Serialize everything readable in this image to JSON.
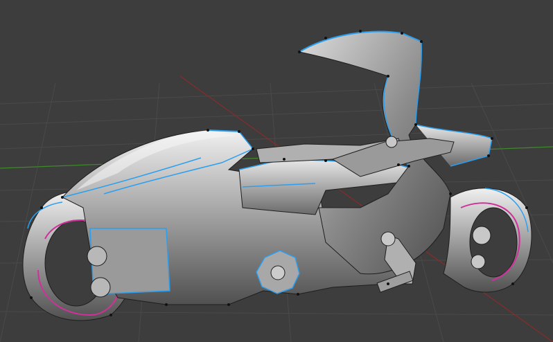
{
  "viewport": {
    "background": "#3d3d3d",
    "grid_color": "#474747",
    "x_axis_color": "#8a2a2a",
    "y_axis_color": "#3f8a2a",
    "mesh_fill_light": "#e6e6e6",
    "mesh_fill_mid": "#9b9b9b",
    "mesh_fill_dark": "#5a5a5a",
    "wire_color": "#1e1e1e",
    "selected_edge_color": "#2a9ff0",
    "seam_edge_color": "#d0309a",
    "vertex_color": "#111111"
  },
  "object": {
    "icon": "motorcycle-mesh",
    "mode": "edit-mode"
  }
}
